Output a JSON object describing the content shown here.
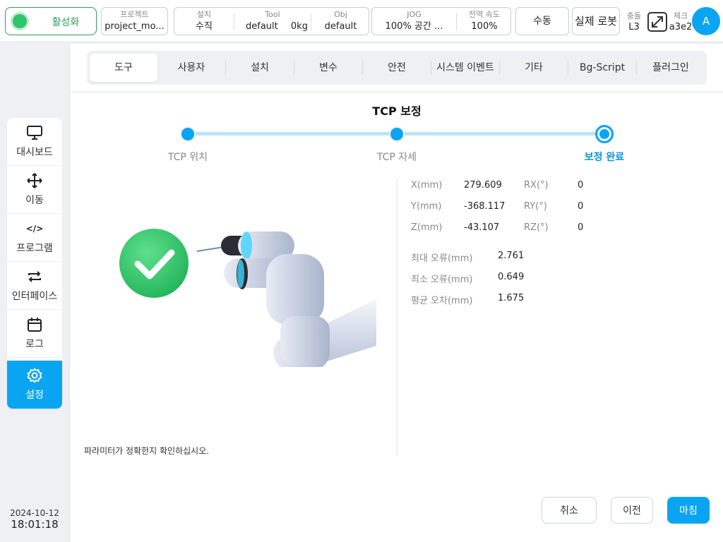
{
  "topbar": {
    "activate_label": "활성화",
    "project_label": "프로젝트",
    "project_value": "project_mo...",
    "install_label": "설치",
    "install_value": "수직",
    "tool_label": "Tool",
    "tool_value": "default",
    "tool_weight": "0kg",
    "obj_label": "Obj",
    "obj_value": "default",
    "jog_label": "JOG",
    "jog_value": "100%  공간 ...",
    "global_speed_label": "전역 속도",
    "global_speed_value": "100%",
    "manual_label": "수동",
    "real_robot_label": "실제 로봇",
    "collision_label": "충돌",
    "collision_value": "L3",
    "check_label": "체크",
    "check_value": "a3e2",
    "avatar_letter": "A"
  },
  "sidebar": {
    "items": [
      {
        "label": "대시보드",
        "icon": "monitor-icon"
      },
      {
        "label": "이동",
        "icon": "move-arrows-icon"
      },
      {
        "label": "프로그램",
        "icon": "code-icon"
      },
      {
        "label": "인터페이스",
        "icon": "swap-arrows-icon"
      },
      {
        "label": "로그",
        "icon": "calendar-icon"
      },
      {
        "label": "설정",
        "icon": "gear-icon",
        "active": true
      }
    ],
    "date": "2024-10-12",
    "time": "18:01:18"
  },
  "tabs": [
    "도구",
    "사용자",
    "설치",
    "변수",
    "안전",
    "시스템 이벤트",
    "기타",
    "Bg-Script",
    "플러그인"
  ],
  "active_tab": "도구",
  "wizard": {
    "title": "TCP 보정",
    "steps": [
      "TCP 위치",
      "TCP 자세",
      "보정 완료"
    ],
    "current_step": 3
  },
  "results": {
    "x_label": "X(mm)",
    "x_value": "279.609",
    "y_label": "Y(mm)",
    "y_value": "-368.117",
    "z_label": "Z(mm)",
    "z_value": "-43.107",
    "rx_label": "RX(°)",
    "rx_value": "0",
    "ry_label": "RY(°)",
    "ry_value": "0",
    "rz_label": "RZ(°)",
    "rz_value": "0",
    "max_error_label": "최대 오류(mm)",
    "max_error_value": "2.761",
    "min_error_label": "최소 오류(mm)",
    "min_error_value": "0.649",
    "avg_error_label": "평균 오차(mm)",
    "avg_error_value": "1.675"
  },
  "confirm_text": "파라미터가 정확한지 확인하십시오.",
  "buttons": {
    "cancel": "취소",
    "prev": "이전",
    "finish": "마침"
  },
  "colors": {
    "accent": "#0aa5f2",
    "success": "#2fc56a",
    "active_green": "#2e9e5b"
  }
}
